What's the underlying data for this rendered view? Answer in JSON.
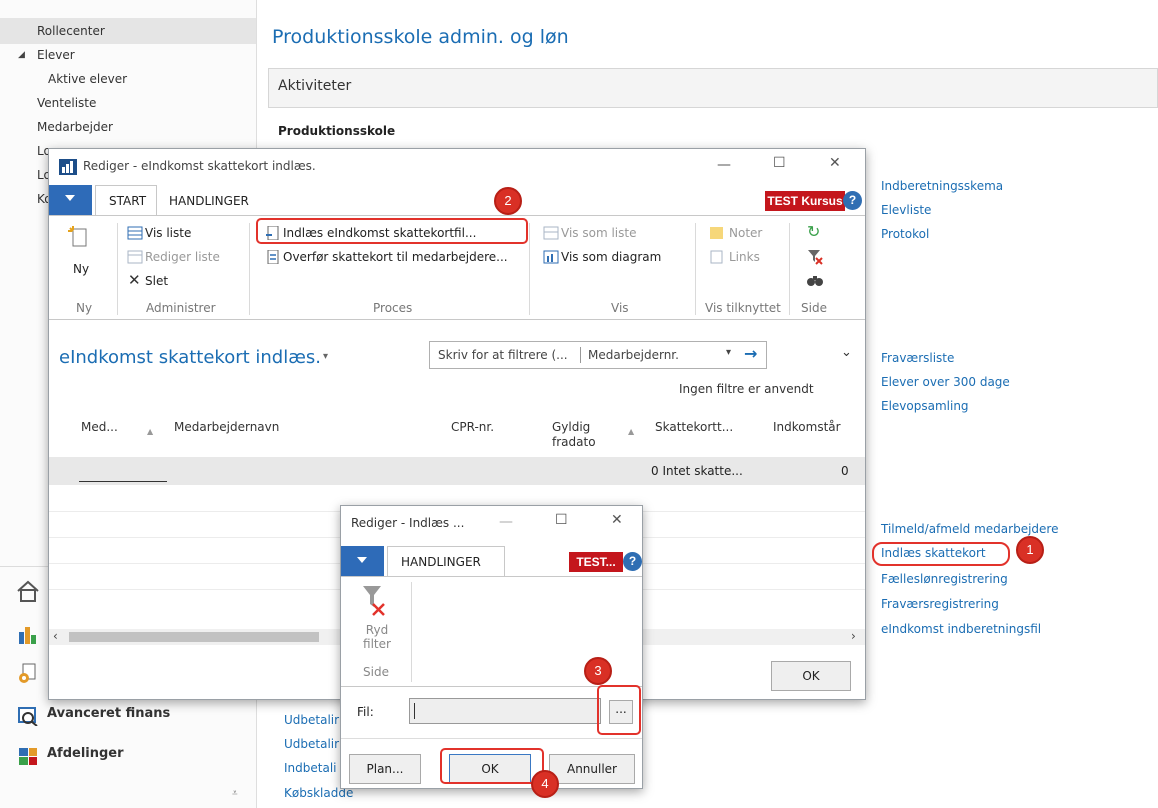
{
  "sidebar": {
    "items": [
      {
        "label": "Rollecenter"
      },
      {
        "label": "Elever"
      },
      {
        "label": "Aktive elever"
      },
      {
        "label": "Venteliste"
      },
      {
        "label": "Medarbejder"
      },
      {
        "label": "Lo"
      },
      {
        "label": "Lo"
      },
      {
        "label": "Ko"
      }
    ],
    "bottom": [
      {
        "label": "Avanceret finans"
      },
      {
        "label": "Afdelinger"
      }
    ]
  },
  "background": {
    "page_title": "Produktionsskole admin. og løn",
    "section_title": "Aktiviteter",
    "group_title": "Produktionsskole",
    "links_group1": [
      "Indberetningsskema",
      "Elevliste",
      "Protokol"
    ],
    "links_group2": [
      "Fraværsliste",
      "Elever over 300 dage",
      "Elevopsamling"
    ],
    "links_group3": [
      "Tilmeld/afmeld medarbejdere",
      "Indlæs skattekort",
      "Fælleslønregistrering",
      "Fraværsregistrering",
      "eIndkomst indberetningsfil"
    ],
    "links_bottom": [
      "Udbetalir",
      "Udbetalir",
      "Indbetali",
      "Købskladde"
    ]
  },
  "main_window": {
    "title": "Rediger - eIndkomst skattekort indlæs.",
    "tabs": [
      "START",
      "HANDLINGER"
    ],
    "test_label": "TEST Kursus",
    "help": "?",
    "ribbon": {
      "ny_label": "Ny",
      "ny_group": "Ny",
      "vis_liste": "Vis liste",
      "rediger_liste": "Rediger liste",
      "slet": "Slet",
      "administrer_group": "Administrer",
      "indlaes": "Indlæs eIndkomst skattekortfil...",
      "overfoer": "Overfør skattekort til medarbejdere...",
      "proces_group": "Proces",
      "vis_som_liste": "Vis som liste",
      "vis_som_diagram": "Vis som diagram",
      "vis_group": "Vis",
      "noter": "Noter",
      "links": "Links",
      "vis_tilknyttet_group": "Vis tilknyttet",
      "side_group": "Side"
    },
    "page_heading": "eIndkomst skattekort indlæs.",
    "filter_placeholder": "Skriv for at filtrere (...",
    "filter_field": "Medarbejdernr.",
    "no_filters": "Ingen filtre er anvendt",
    "columns": [
      "Med...",
      "Medarbejdernavn",
      "CPR-nr.",
      "Gyldig fradato",
      "Skattekortt...",
      "Indkomstår"
    ],
    "row": {
      "skattekort": "0 Intet skatte...",
      "indkomstaar": "0"
    },
    "ok": "OK"
  },
  "dialog": {
    "title": "Rediger - Indlæs ...",
    "tab": "HANDLINGER",
    "test_label": "TEST...",
    "help": "?",
    "ryd_filter": "Ryd filter",
    "side_group": "Side",
    "fil_label": "Fil:",
    "fil_value": "",
    "browse": "...",
    "plan": "Plan...",
    "ok": "OK",
    "annuller": "Annuller"
  },
  "annotations": [
    "1",
    "2",
    "3",
    "4"
  ],
  "colors": {
    "accent_blue": "#1b6db3",
    "tab_blue": "#2e6bb8",
    "test_red": "#c4161c",
    "annotation_red": "#e2322b"
  }
}
